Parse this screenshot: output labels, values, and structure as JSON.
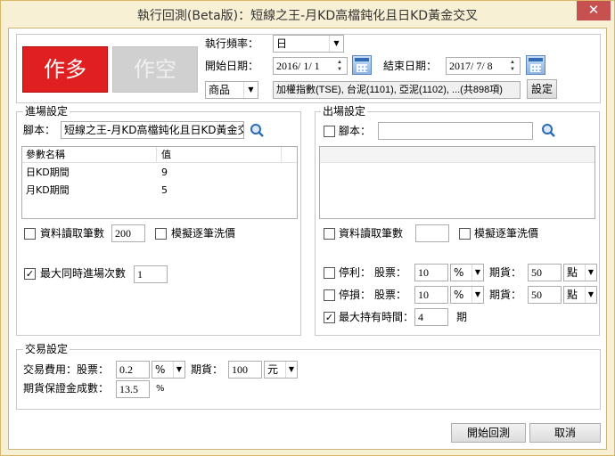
{
  "window": {
    "title": "執行回測(Beta版)：短線之王-月KD高檔鈍化且日KD黃金交叉"
  },
  "top": {
    "long_button": "作多",
    "short_button": "作空",
    "frequency_label": "執行頻率：",
    "frequency_value": "日",
    "start_label": "開始日期：",
    "start_value": "2016/ 1/ 1",
    "end_label": "結束日期：",
    "end_value": "2017/ 7/ 8",
    "product_type": "商品",
    "products_value": "加權指數(TSE), 台泥(1101), 亞泥(1102), ...(共898項)",
    "settings_button": "設定"
  },
  "entry": {
    "legend": "進場設定",
    "script_label": "腳本：",
    "script_value": "短線之王-月KD高檔鈍化且日KD黃金交",
    "columns": [
      "參數名稱",
      "值"
    ],
    "rows": [
      {
        "name": "日KD期間",
        "value": "9"
      },
      {
        "name": "月KD期間",
        "value": "5"
      }
    ],
    "read_bars_label": "資料讀取筆數",
    "read_bars_value": "200",
    "read_bars_checked": false,
    "simulate_label": "模擬逐筆洗價",
    "simulate_checked": false,
    "max_entries_label": "最大同時進場次數",
    "max_entries_value": "1",
    "max_entries_checked": true
  },
  "exit": {
    "legend": "出場設定",
    "script_label": "腳本：",
    "script_value": "",
    "script_checked": false,
    "read_bars_label": "資料讀取筆數",
    "read_bars_value": "",
    "simulate_label": "模擬逐筆洗價",
    "stop_profit_label": "停利：",
    "stop_loss_label": "停損：",
    "stock_label": "股票：",
    "futures_label": "期貨：",
    "stop_profit_stock": "10",
    "stop_profit_stock_unit": "%",
    "stop_profit_futures": "50",
    "stop_profit_futures_unit": "點",
    "stop_loss_stock": "10",
    "stop_loss_stock_unit": "%",
    "stop_loss_futures": "50",
    "stop_loss_futures_unit": "點",
    "max_hold_label": "最大持有時間：",
    "max_hold_value": "4",
    "max_hold_unit": "期",
    "max_hold_checked": true
  },
  "trade": {
    "legend": "交易設定",
    "fee_label": "交易費用：股票：",
    "fee_stock_value": "0.2",
    "fee_stock_unit": "%",
    "fee_futures_label": "期貨：",
    "fee_futures_value": "100",
    "fee_futures_unit": "元",
    "margin_label": "期貨保證金成數：",
    "margin_value": "13.5",
    "margin_unit": "%"
  },
  "footer": {
    "start_button": "開始回測",
    "cancel_button": "取消"
  },
  "colors": {
    "long_button": "#e02020",
    "short_button": "#d0d0d0",
    "frame": "#f8f0d4",
    "close": "#c75050"
  }
}
